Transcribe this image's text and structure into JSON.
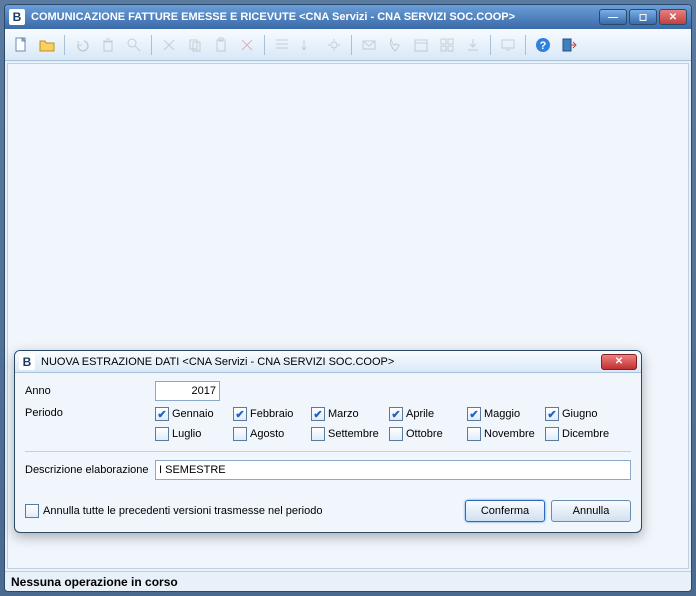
{
  "window": {
    "icon_letter": "B",
    "title": "COMUNICAZIONE FATTURE EMESSE E RICEVUTE <CNA Servizi - CNA SERVIZI SOC.COOP>"
  },
  "toolbar": {
    "icons": [
      "new-doc-icon",
      "open-folder-icon",
      "undo-icon",
      "delete-icon",
      "find-icon",
      "cut-icon",
      "copy-icon",
      "paste-icon",
      "clear-icon",
      "list-icon",
      "sort-icon",
      "gear-icon",
      "mail-icon",
      "phone-icon",
      "calendar-icon",
      "grid-icon",
      "export-icon",
      "monitor-icon",
      "help-icon",
      "exit-icon"
    ]
  },
  "dialog": {
    "icon_letter": "B",
    "title": "NUOVA ESTRAZIONE DATI <CNA Servizi - CNA SERVIZI SOC.COOP>",
    "anno_label": "Anno",
    "anno_value": "2017",
    "periodo_label": "Periodo",
    "months": [
      {
        "label": "Gennaio",
        "checked": true
      },
      {
        "label": "Febbraio",
        "checked": true
      },
      {
        "label": "Marzo",
        "checked": true
      },
      {
        "label": "Aprile",
        "checked": true
      },
      {
        "label": "Maggio",
        "checked": true
      },
      {
        "label": "Giugno",
        "checked": true
      },
      {
        "label": "Luglio",
        "checked": false
      },
      {
        "label": "Agosto",
        "checked": false
      },
      {
        "label": "Settembre",
        "checked": false
      },
      {
        "label": "Ottobre",
        "checked": false
      },
      {
        "label": "Novembre",
        "checked": false
      },
      {
        "label": "Dicembre",
        "checked": false
      }
    ],
    "descrizione_label": "Descrizione elaborazione",
    "descrizione_value": "I SEMESTRE",
    "annulla_precedenti_label": "Annulla tutte le precedenti versioni trasmesse nel periodo",
    "annulla_precedenti_checked": false,
    "confirm_label": "Conferma",
    "cancel_label": "Annulla"
  },
  "statusbar": {
    "text": "Nessuna operazione in corso"
  }
}
